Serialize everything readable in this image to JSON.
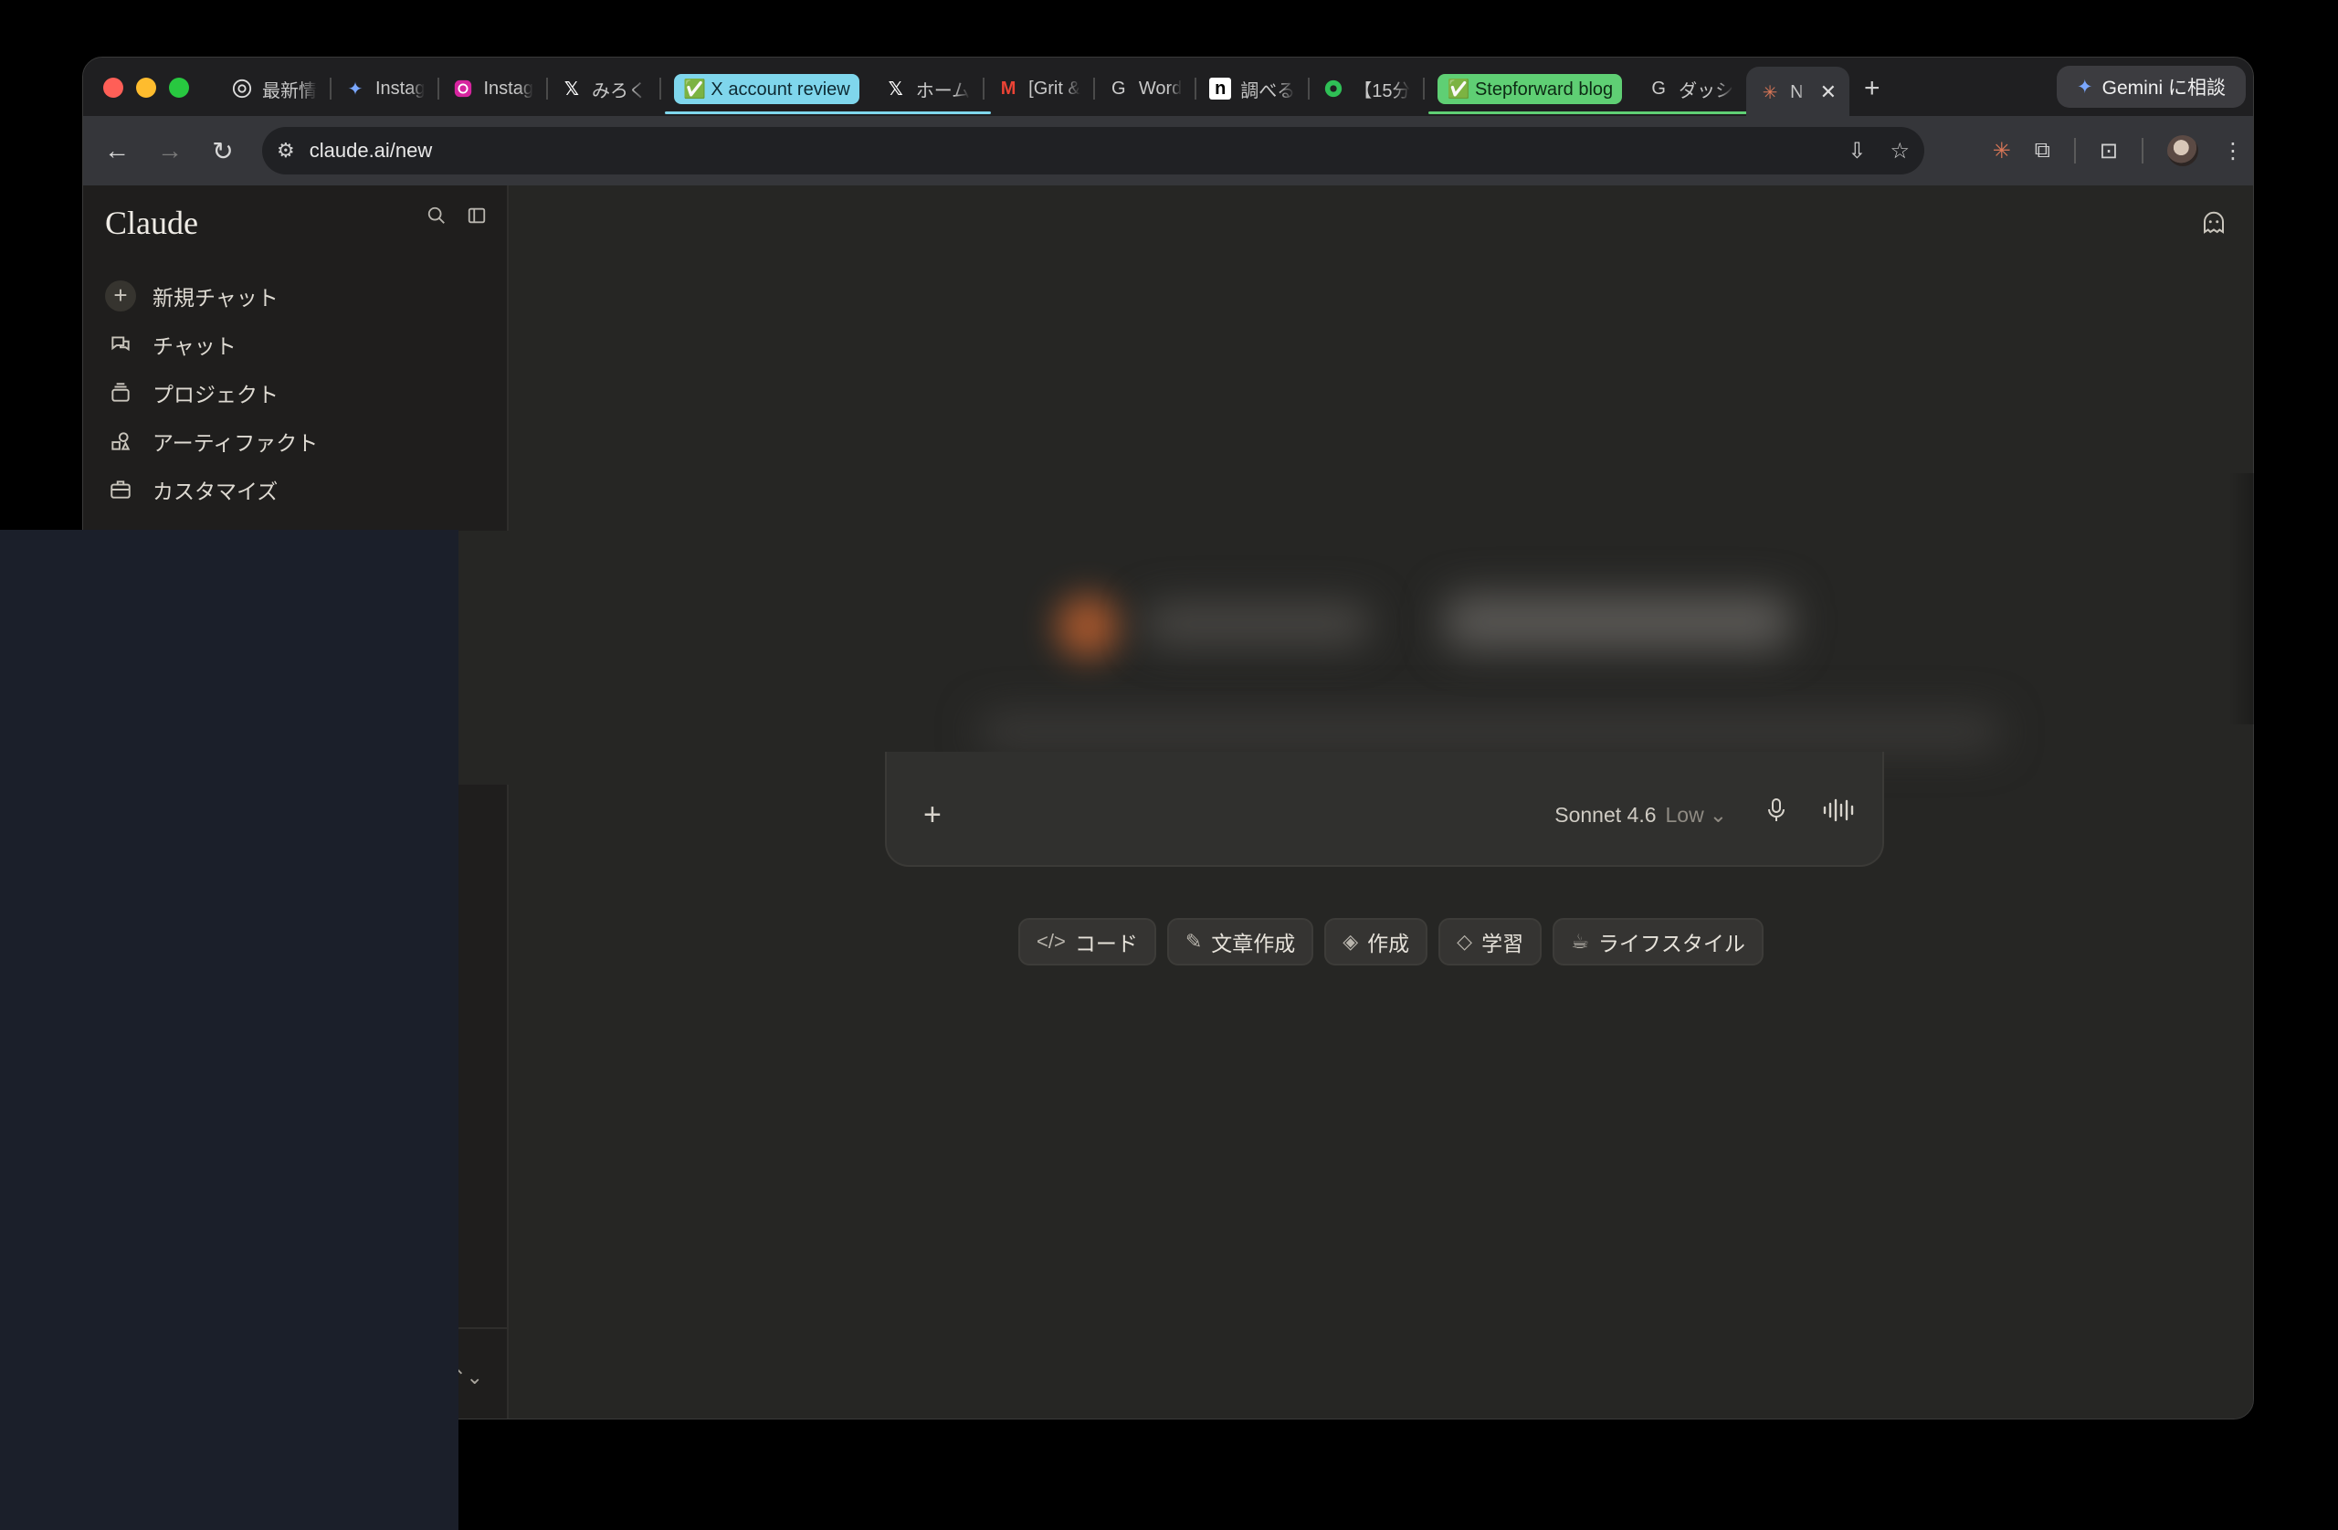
{
  "browser": {
    "tabs": [
      {
        "label": "最新情",
        "icon": "chrome-icon"
      },
      {
        "label": "Instag",
        "icon": "gemini-icon"
      },
      {
        "label": "Instag",
        "icon": "instagram-icon"
      },
      {
        "label": "みろく",
        "icon": "x-icon"
      },
      {
        "label": "✅ X account review",
        "group": "cyan"
      },
      {
        "label": "ホーム",
        "icon": "x-icon"
      },
      {
        "label": "[Grit &",
        "icon": "gmail-icon"
      },
      {
        "label": "Word",
        "icon": "google-icon"
      },
      {
        "label": "調べる",
        "icon": "note-icon"
      },
      {
        "label": "【15分",
        "icon": "green-app-icon"
      },
      {
        "label": "✅ Stepforward blog",
        "group": "green"
      },
      {
        "label": "ダッシ",
        "icon": "google-icon"
      },
      {
        "label": "N",
        "icon": "claude-icon",
        "active": true
      }
    ],
    "gemini_button": "Gemini に相談",
    "url": "claude.ai/new"
  },
  "sidebar": {
    "brand": "Claude",
    "items": [
      {
        "label": "新規チャット"
      },
      {
        "label": "チャット"
      },
      {
        "label": "プロジェクト"
      },
      {
        "label": "アーティファクト"
      },
      {
        "label": "カスタマイズ"
      }
    ]
  },
  "composer": {
    "model": "Sonnet 4.6",
    "effort": "Low"
  },
  "chips": [
    {
      "label": "コード"
    },
    {
      "label": "文章作成"
    },
    {
      "label": "作成"
    },
    {
      "label": "学習"
    },
    {
      "label": "ライフスタイル"
    }
  ],
  "colors": {
    "tab_group_cyan": "#7fd6ec",
    "tab_group_green": "#5fcf74",
    "claude_accent": "#d97757"
  }
}
